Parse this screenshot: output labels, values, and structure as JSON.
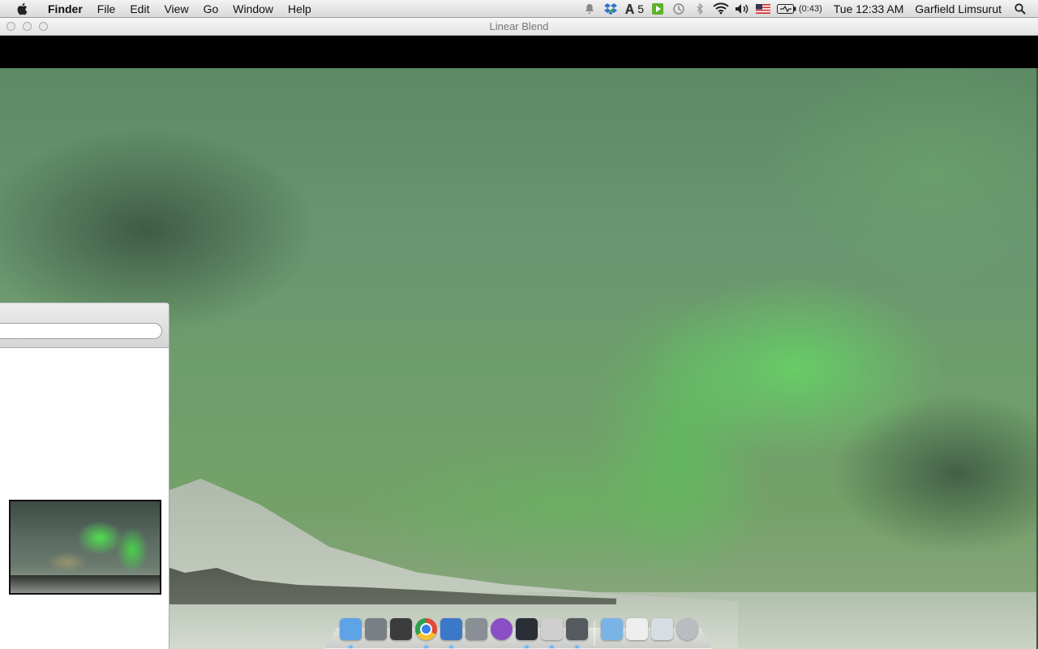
{
  "menubar": {
    "apple_icon": "apple-icon",
    "menus": [
      "Finder",
      "File",
      "Edit",
      "View",
      "Go",
      "Window",
      "Help"
    ],
    "status": {
      "adobe_count": "5",
      "battery_time": "(0:43)",
      "clock": "Tue 12:33 AM",
      "user": "Garfield Limsurut"
    }
  },
  "window": {
    "title": "Linear Blend"
  },
  "side_panel": {
    "search_value": ""
  },
  "dock": {
    "items": [
      {
        "name": "finder",
        "icon": "finder-icon",
        "color": "#5ea3e6",
        "running": true
      },
      {
        "name": "launchpad",
        "icon": "rocket-icon",
        "color": "#7a7f86",
        "running": false
      },
      {
        "name": "photo-booth",
        "icon": "photo-booth-icon",
        "color": "#3c3c3c",
        "running": false
      },
      {
        "name": "chrome",
        "icon": "chrome-icon",
        "color": "#e04a3a",
        "running": true
      },
      {
        "name": "xcode",
        "icon": "xcode-icon",
        "color": "#3c78c8",
        "running": true
      },
      {
        "name": "system-preferences",
        "icon": "gear-icon",
        "color": "#8a8f96",
        "running": false
      },
      {
        "name": "torrent",
        "icon": "torrent-icon",
        "color": "#8a4fc4",
        "running": false
      },
      {
        "name": "steam",
        "icon": "steam-icon",
        "color": "#2a2e36",
        "running": true
      },
      {
        "name": "script-editor",
        "icon": "script-icon",
        "color": "#cfcfcf",
        "running": true
      },
      {
        "name": "terminal",
        "icon": "terminal-icon",
        "color": "#555a5e",
        "running": true
      },
      {
        "name": "applications-folder",
        "icon": "folder-icon",
        "color": "#7ab4e6",
        "running": false
      },
      {
        "name": "documents",
        "icon": "document-icon",
        "color": "#eeeeee",
        "running": false
      },
      {
        "name": "preview-stack",
        "icon": "stack-icon",
        "color": "#d8dde3",
        "running": false
      },
      {
        "name": "trash",
        "icon": "trash-icon",
        "color": "#b9bcc0",
        "running": false
      }
    ]
  }
}
